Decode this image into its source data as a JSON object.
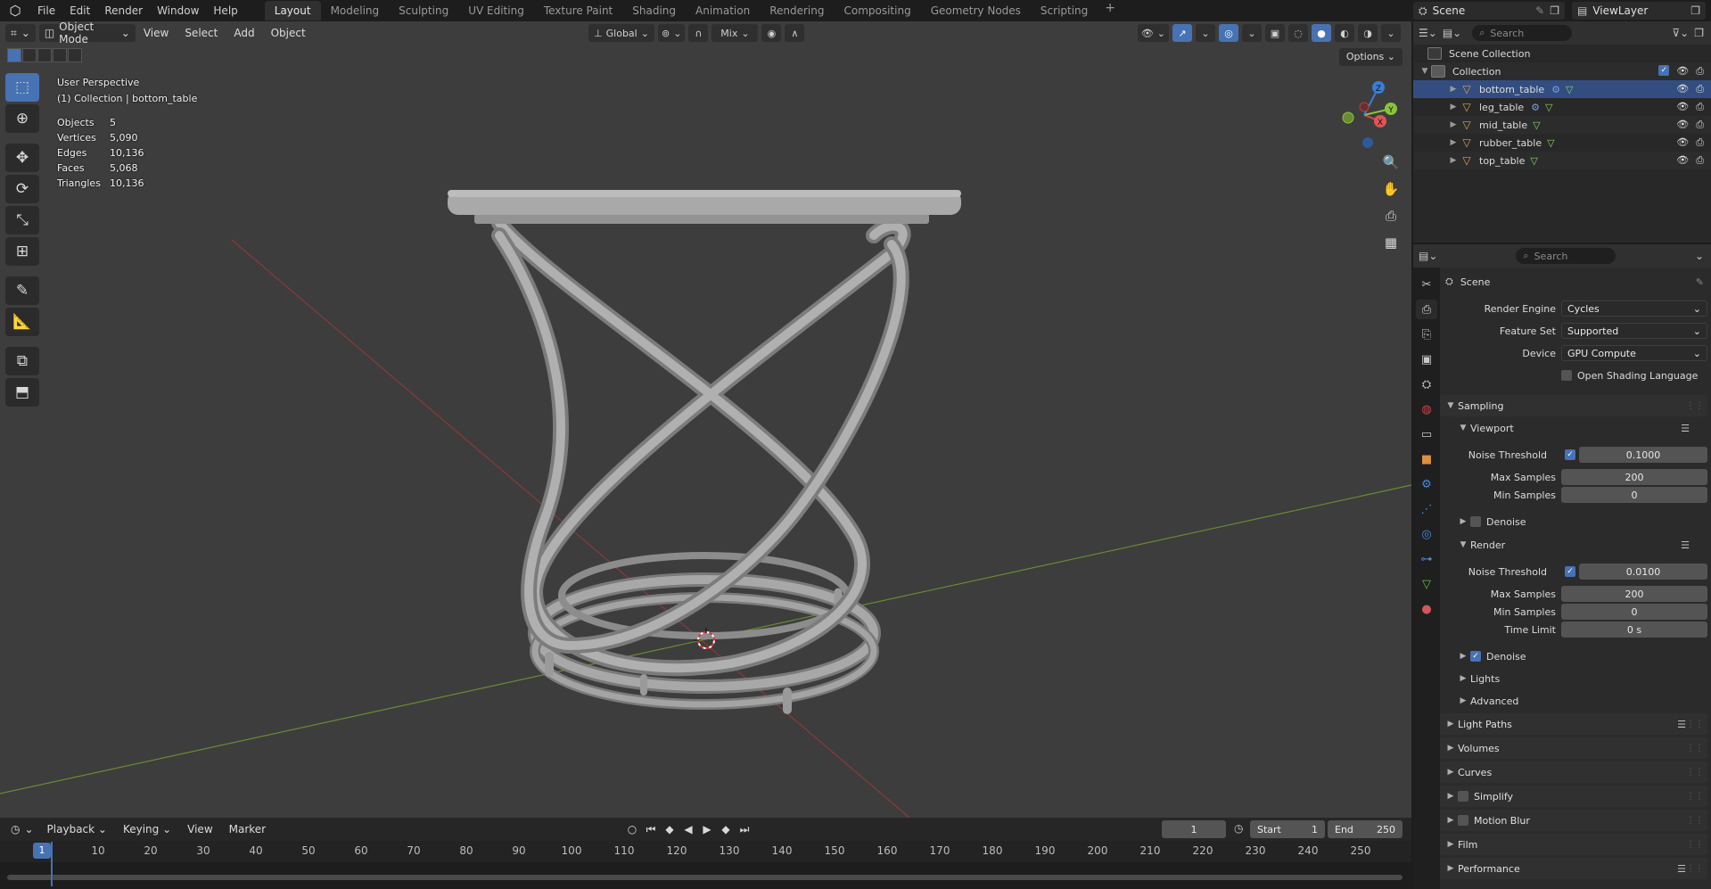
{
  "menu": {
    "items": [
      "File",
      "Edit",
      "Render",
      "Window",
      "Help"
    ],
    "workspaces": [
      "Layout",
      "Modeling",
      "Sculpting",
      "UV Editing",
      "Texture Paint",
      "Shading",
      "Animation",
      "Rendering",
      "Compositing",
      "Geometry Nodes",
      "Scripting"
    ],
    "active_workspace": "Layout",
    "add_tab": "+",
    "scene": "Scene",
    "view_layer": "ViewLayer"
  },
  "viewport_header": {
    "mode": "Object Mode",
    "menus": [
      "View",
      "Select",
      "Add",
      "Object"
    ],
    "orientation": "Global",
    "snap_mode": "Mix",
    "options": "Options"
  },
  "viewport_info": {
    "perspective": "User Perspective",
    "context": "(1) Collection | bottom_table"
  },
  "stats": [
    {
      "label": "Objects",
      "value": "5"
    },
    {
      "label": "Vertices",
      "value": "5,090"
    },
    {
      "label": "Edges",
      "value": "10,136"
    },
    {
      "label": "Faces",
      "value": "5,068"
    },
    {
      "label": "Triangles",
      "value": "10,136"
    }
  ],
  "gizmo": {
    "x": "X",
    "y": "Y",
    "z": "Z"
  },
  "timeline": {
    "menus": [
      "Playback",
      "Keying",
      "View",
      "Marker"
    ],
    "current_frame": "1",
    "start_label": "Start",
    "start": "1",
    "end_label": "End",
    "end": "250",
    "ticks": [
      "1",
      "10",
      "20",
      "30",
      "40",
      "50",
      "60",
      "70",
      "80",
      "90",
      "100",
      "110",
      "120",
      "130",
      "140",
      "150",
      "160",
      "170",
      "180",
      "190",
      "200",
      "210",
      "220",
      "230",
      "240",
      "250"
    ]
  },
  "outliner": {
    "search_placeholder": "Search",
    "scene_collection": "Scene Collection",
    "collection": "Collection",
    "objects": [
      "bottom_table",
      "leg_table",
      "mid_table",
      "rubber_table",
      "top_table"
    ]
  },
  "properties": {
    "search_placeholder": "Search",
    "context": "Scene",
    "render_engine_label": "Render Engine",
    "render_engine": "Cycles",
    "feature_set_label": "Feature Set",
    "feature_set": "Supported",
    "device_label": "Device",
    "device": "GPU Compute",
    "osl": "Open Shading Language",
    "sampling": "Sampling",
    "viewport": "Viewport",
    "noise_threshold_label": "Noise Threshold",
    "viewport_noise_threshold": "0.1000",
    "max_samples_label": "Max Samples",
    "viewport_max_samples": "200",
    "min_samples_label": "Min Samples",
    "viewport_min_samples": "0",
    "denoise": "Denoise",
    "render": "Render",
    "render_noise_threshold": "0.0100",
    "render_max_samples": "200",
    "render_min_samples": "0",
    "time_limit_label": "Time Limit",
    "time_limit": "0 s",
    "lights": "Lights",
    "advanced": "Advanced",
    "light_paths": "Light Paths",
    "volumes": "Volumes",
    "curves": "Curves",
    "simplify": "Simplify",
    "motion_blur": "Motion Blur",
    "film": "Film",
    "performance": "Performance"
  },
  "colors": {
    "accent": "#4772b3",
    "viewport_bg": "#3d3d3d",
    "x_axis": "#c0393b",
    "y_axis": "#7ea53a",
    "object_icon": "#e0a050"
  }
}
